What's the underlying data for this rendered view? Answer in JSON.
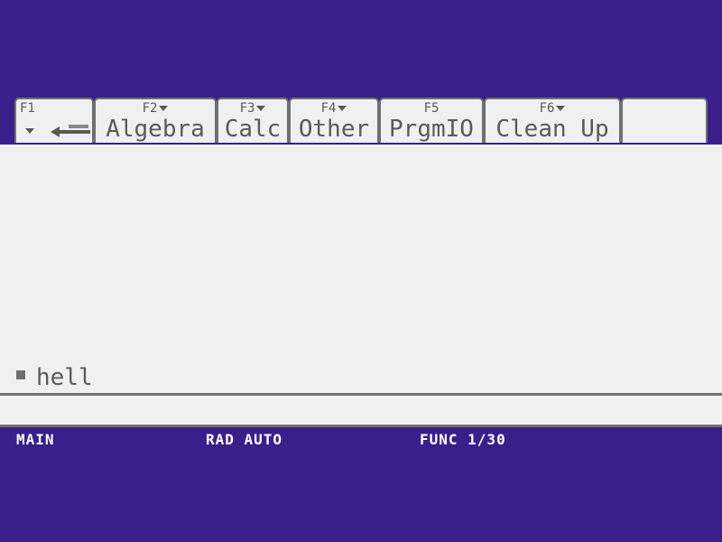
{
  "toolbar": {
    "tabs": [
      {
        "fkey": "F1",
        "label": "",
        "has_menu": true
      },
      {
        "fkey": "F2",
        "label": "Algebra",
        "has_menu": true
      },
      {
        "fkey": "F3",
        "label": "Calc",
        "has_menu": true
      },
      {
        "fkey": "F4",
        "label": "Other",
        "has_menu": true
      },
      {
        "fkey": "F5",
        "label": "PrgmIO",
        "has_menu": false
      },
      {
        "fkey": "F6",
        "label": "Clean Up",
        "has_menu": true
      },
      {
        "fkey": "",
        "label": "",
        "has_menu": false
      }
    ],
    "f1_icon": "undo-icon"
  },
  "history": {
    "entries": [
      {
        "input": "hell"
      }
    ]
  },
  "entry_line": {
    "value": ""
  },
  "status": {
    "folder": "MAIN",
    "mode": "RAD AUTO",
    "graph_mode": "FUNC 1/30"
  },
  "colors": {
    "background": "#3a1f8a",
    "screen": "#f0f0f0",
    "text": "#5a5a5a",
    "status_text": "#ffffff"
  }
}
